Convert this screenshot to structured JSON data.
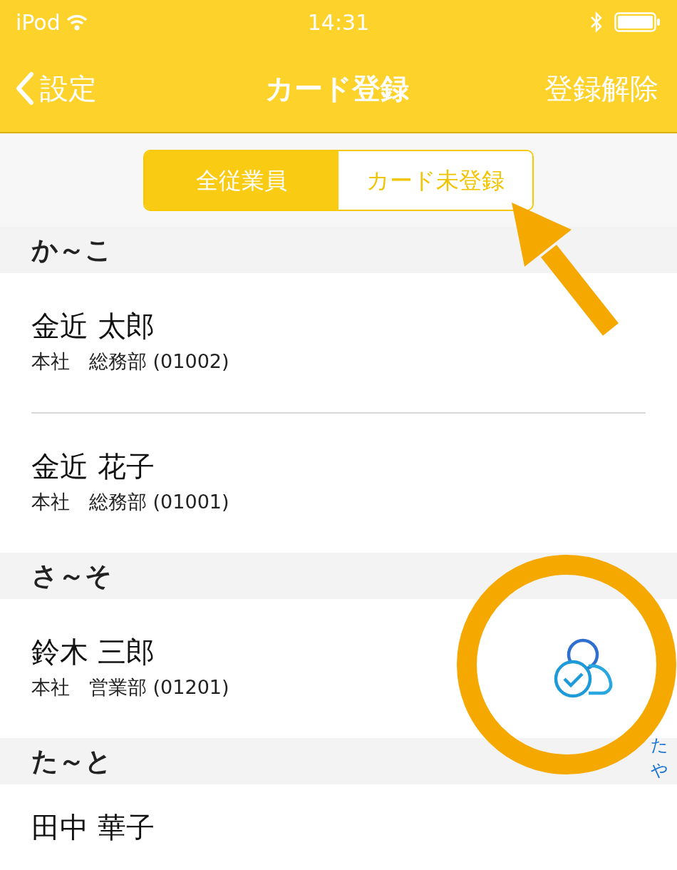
{
  "status_bar": {
    "carrier": "iPod",
    "time": "14:31"
  },
  "nav": {
    "back": "設定",
    "title": "カード登録",
    "action": "登録解除"
  },
  "segments": [
    {
      "label": "全従業員",
      "selected": true
    },
    {
      "label": "カード未登録",
      "selected": false
    }
  ],
  "sections": [
    {
      "header": "か～こ",
      "rows": [
        {
          "name": "金近 太郎",
          "detail": "本社　総務部 (01002)"
        },
        {
          "name": "金近 花子",
          "detail": "本社　総務部 (01001)"
        }
      ]
    },
    {
      "header": "さ～そ",
      "rows": [
        {
          "name": "鈴木 三郎",
          "detail": "本社　営業部 (01201)"
        }
      ]
    },
    {
      "header": "た～と",
      "rows": [
        {
          "name": "田中 華子"
        }
      ]
    }
  ],
  "index": [
    "た",
    "や"
  ]
}
